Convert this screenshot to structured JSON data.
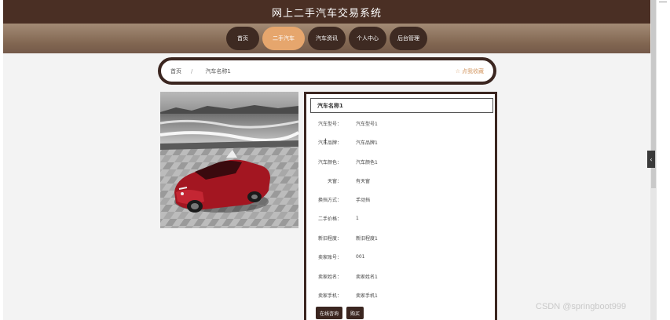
{
  "header": {
    "site_title": "网上二手汽车交易系统"
  },
  "nav": {
    "items": [
      {
        "label": "首页",
        "active": false
      },
      {
        "label": "二手汽车",
        "active": true
      },
      {
        "label": "汽车资讯",
        "active": false
      },
      {
        "label": "个人中心",
        "active": false
      },
      {
        "label": "后台管理",
        "active": false
      }
    ]
  },
  "breadcrumb": {
    "home": "首页",
    "separator": "/",
    "current": "汽车名称1",
    "favorite": "点我收藏"
  },
  "detail": {
    "title": "汽车名称1",
    "fields": [
      {
        "label": "汽车型号：",
        "value": "汽车型号1"
      },
      {
        "label": "汽车品牌：",
        "value": "汽车品牌1"
      },
      {
        "label": "汽车颜色：",
        "value": "汽车颜色1"
      },
      {
        "label": "天窗：",
        "value": "有天窗"
      },
      {
        "label": "换挡方式：",
        "value": "手动挡"
      },
      {
        "label": "二手价格：",
        "value": "1"
      },
      {
        "label": "新旧程度：",
        "value": "新旧程度1"
      },
      {
        "label": "卖家账号：",
        "value": "001"
      },
      {
        "label": "卖家姓名：",
        "value": "卖家姓名1"
      },
      {
        "label": "卖家手机：",
        "value": "卖家手机1"
      }
    ],
    "buttons": {
      "consult": "在线咨询",
      "buy": "购买"
    }
  },
  "side_tab": {
    "label": "‹"
  },
  "watermark": "CSDN @springboot999",
  "colors": {
    "dark_brown": "#3b2620",
    "accent": "#e6a66d",
    "nav_bg": "#806550"
  }
}
